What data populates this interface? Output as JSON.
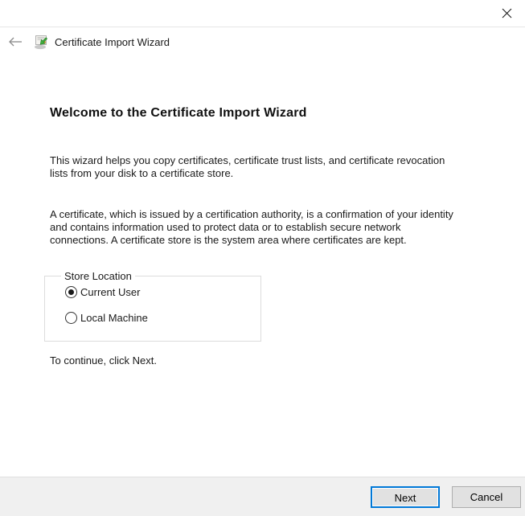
{
  "header": {
    "title": "Certificate Import Wizard"
  },
  "main": {
    "heading": "Welcome to the Certificate Import Wizard",
    "paragraph1": "This wizard helps you copy certificates, certificate trust lists, and certificate revocation\nlists from your disk to a certificate store.",
    "paragraph2": "A certificate, which is issued by a certification authority, is a confirmation of your identity\nand contains information used to protect data or to establish secure network\nconnections. A certificate store is the system area where certificates are kept.",
    "store_location": {
      "legend": "Store Location",
      "options": [
        {
          "label": "Current User",
          "selected": true
        },
        {
          "label": "Local Machine",
          "selected": false
        }
      ]
    },
    "continue_hint": "To continue, click Next."
  },
  "footer": {
    "next_label": "Next",
    "cancel_label": "Cancel"
  },
  "icons": {
    "close": "close-icon",
    "back": "back-arrow-icon",
    "certificate": "certificate-icon"
  },
  "colors": {
    "accent": "#0078d7",
    "footer_bg": "#f0f0f0",
    "button_bg": "#e1e1e1",
    "button_border": "#adadad",
    "separator": "#e5e5e5"
  }
}
